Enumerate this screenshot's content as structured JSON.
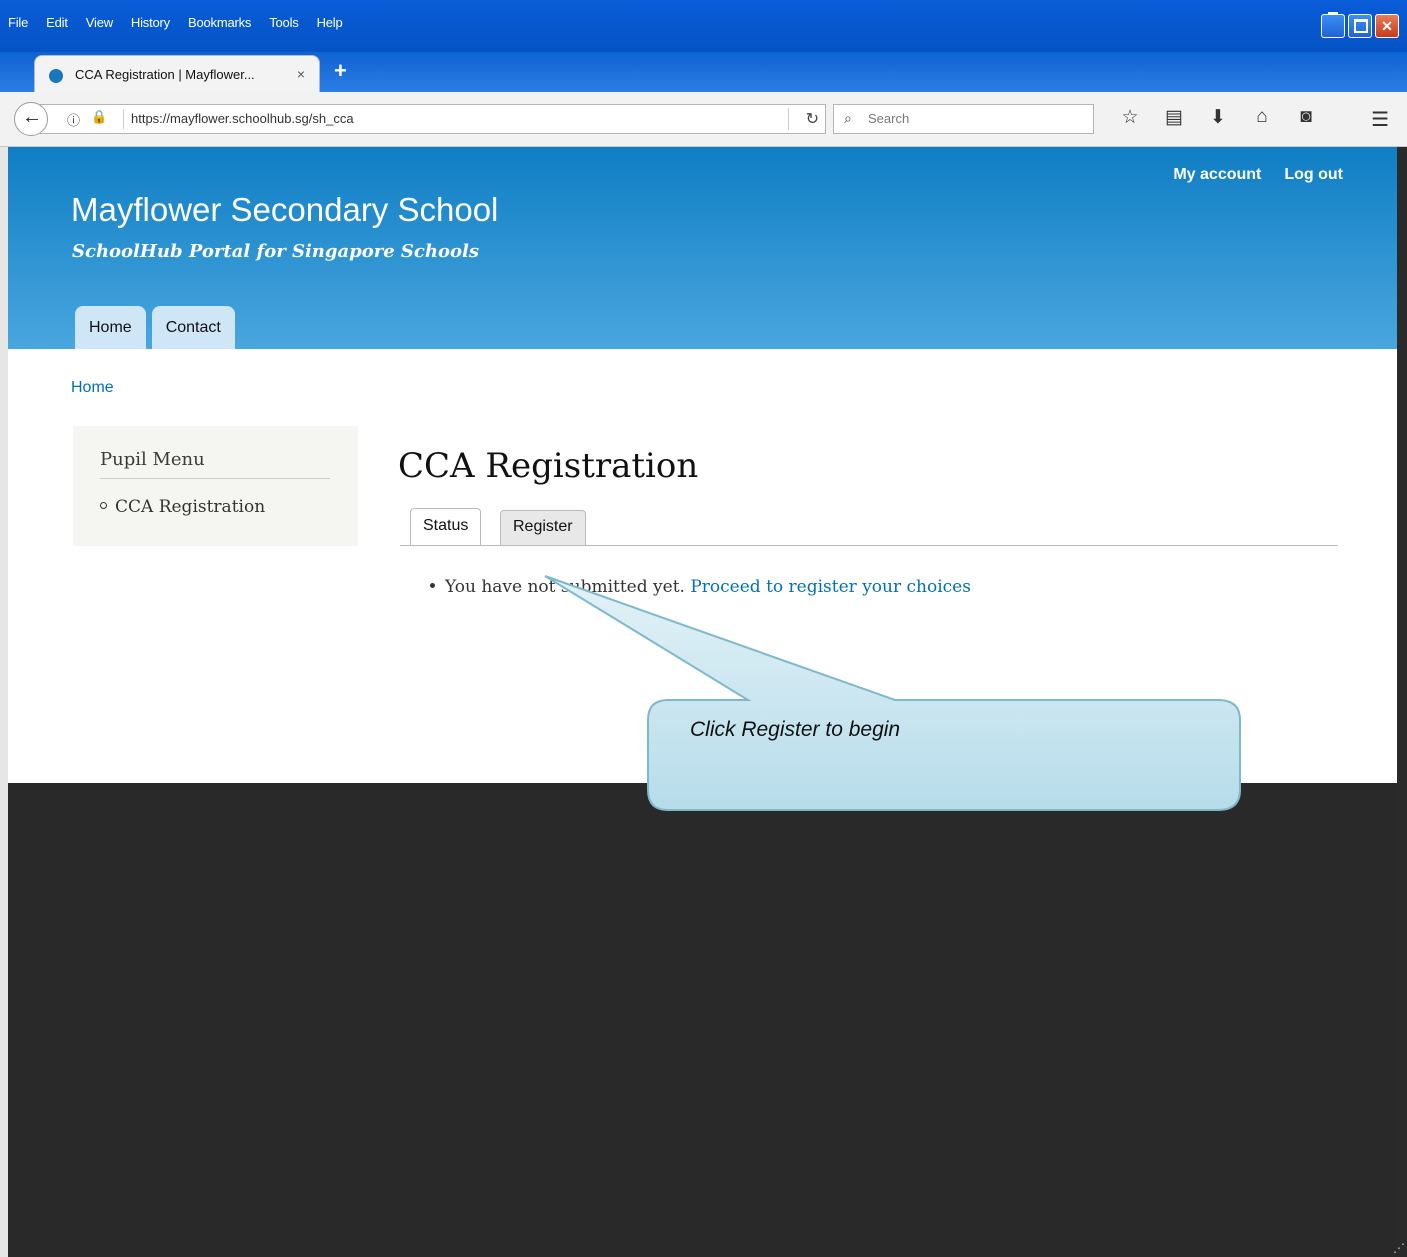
{
  "browser": {
    "menu": [
      "File",
      "Edit",
      "View",
      "History",
      "Bookmarks",
      "Tools",
      "Help"
    ],
    "tab_title": "CCA Registration | Mayflower...",
    "tab_close": "×",
    "new_tab": "+",
    "url": "https://mayflower.schoolhub.sg/sh_cca",
    "search_placeholder": "Search"
  },
  "site": {
    "name": "Mayflower Secondary School",
    "slogan": "SchoolHub Portal for Singapore Schools",
    "secondary_menu": [
      "My account",
      "Log out"
    ],
    "main_menu": [
      "Home",
      "Contact"
    ],
    "breadcrumb": "Home"
  },
  "sidebar": {
    "title": "Pupil Menu",
    "items": [
      "CCA Registration"
    ]
  },
  "main": {
    "title": "CCA Registration",
    "tabs": [
      "Status",
      "Register"
    ],
    "status_text": "You have not submitted yet.",
    "status_link": "Proceed to register your choices"
  },
  "callout": {
    "text": "Click Register to begin"
  },
  "colors": {
    "header_top": "#0f7ec4",
    "header_bottom": "#49a6de",
    "link": "#0071b3",
    "footer": "#292929"
  }
}
